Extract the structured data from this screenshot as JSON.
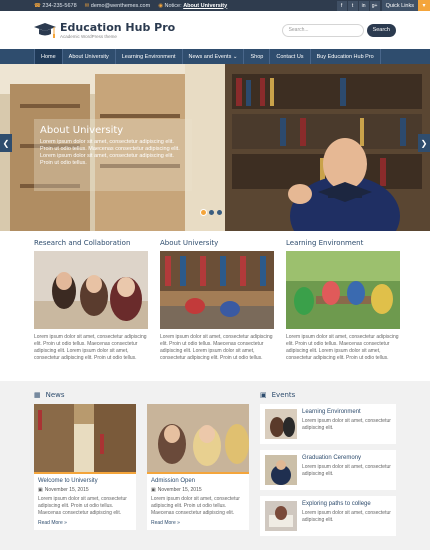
{
  "topbar": {
    "phone": "234-235-5678",
    "email": "demo@wenthemes.com",
    "notice_label": "Notice:",
    "notice_link": "About University",
    "quick_links": "Quick Links",
    "social": [
      "f",
      "t",
      "in",
      "g+"
    ]
  },
  "header": {
    "title": "Education Hub Pro",
    "tagline": "Academic WordPress theme",
    "search_placeholder": "Search...",
    "search_button": "Search"
  },
  "nav": [
    "Home",
    "About University",
    "Learning Environment",
    "News and Events",
    "Shop",
    "Contact Us",
    "Buy Education Hub Pro"
  ],
  "hero": {
    "title": "About University",
    "text": "Lorem ipsum dolor sit amet, consectetur adipiscing elit. Proin ut odio tellus. Maecenas consectetur adipiscing elit. Lorem ipsum dolor sit amet, consectetur adipiscing elit. Proin ut odio tellus."
  },
  "features": [
    {
      "title": "Research and Collaboration",
      "text": "Lorem ipsum dolor sit amet, consectetur adipiscing elit. Proin ut odio tellus. Maecenas consectetur adipiscing elit. Lorem ipsum dolor sit amet, consectetur adipiscing elit. Proin ut odio tellus."
    },
    {
      "title": "About University",
      "text": "Lorem ipsum dolor sit amet, consectetur adipiscing elit. Proin ut odio tellus. Maecenas consectetur adipiscing elit. Lorem ipsum dolor sit amet, consectetur adipiscing elit. Proin ut odio tellus."
    },
    {
      "title": "Learning Environment",
      "text": "Lorem ipsum dolor sit amet, consectetur adipiscing elit. Proin ut odio tellus. Maecenas consectetur adipiscing elit. Lorem ipsum dolor sit amet, consectetur adipiscing elit. Proin ut odio tellus."
    }
  ],
  "news": {
    "heading": "News",
    "items": [
      {
        "title": "Welcome to University",
        "date": "November 15, 2015",
        "text": "Lorem ipsum dolor sit amet, consectetur adipiscing elit. Proin ut odio tellus. Maecenas consectetur adipiscing elit.",
        "more": "Read More »"
      },
      {
        "title": "Admission Open",
        "date": "November 15, 2015",
        "text": "Lorem ipsum dolor sit amet, consectetur adipiscing elit. Proin ut odio tellus. Maecenas consectetur adipiscing elit.",
        "more": "Read More »"
      }
    ]
  },
  "events": {
    "heading": "Events",
    "items": [
      {
        "title": "Learning Environment",
        "text": "Lorem ipsum dolor sit amet, consectetur adipiscing elit."
      },
      {
        "title": "Graduation Ceremony",
        "text": "Lorem ipsum dolor sit amet, consectetur adipiscing elit."
      },
      {
        "title": "Exploring paths to college",
        "text": "Lorem ipsum dolor sit amet, consectetur adipiscing elit."
      }
    ]
  }
}
